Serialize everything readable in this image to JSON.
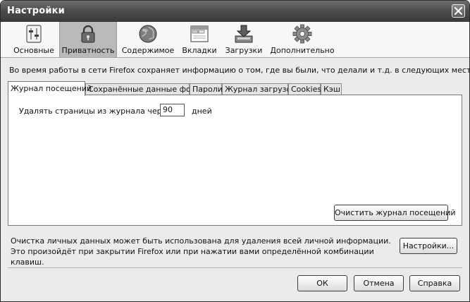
{
  "window": {
    "title": "Настройки"
  },
  "toolbar": {
    "items": [
      {
        "label": "Основные",
        "icon": "switch-panel-icon",
        "active": false
      },
      {
        "label": "Приватность",
        "icon": "padlock-icon",
        "active": true
      },
      {
        "label": "Содержимое",
        "icon": "globe-icon",
        "active": false
      },
      {
        "label": "Вкладки",
        "icon": "tabbed-window-icon",
        "active": false
      },
      {
        "label": "Загрузки",
        "icon": "download-tray-icon",
        "active": false
      },
      {
        "label": "Дополнительно",
        "icon": "gear-icon",
        "active": false
      }
    ]
  },
  "intro": "Во время работы в сети Firefox сохраняет информацию о том, где вы были, что делали и т.д. в следующих местах:",
  "tabs": [
    {
      "label": "Журнал посещений",
      "active": true
    },
    {
      "label": "Сохранённые данные форм",
      "active": false
    },
    {
      "label": "Пароли",
      "active": false
    },
    {
      "label": "Журнал загрузок",
      "active": false
    },
    {
      "label": "Cookies",
      "active": false
    },
    {
      "label": "Кэш",
      "active": false
    }
  ],
  "history": {
    "delete_label": "Удалять страницы из журнала через",
    "days_value": "90",
    "days_unit": "дней",
    "clear_button": "Очистить журнал посещений"
  },
  "clear_private": {
    "text": "Очистка личных данных может быть использована для удаления всей личной информации. Это произойдёт при закрытии Firefox или при нажатии вами определённой комбинации клавиш.",
    "settings_button": "Настройки..."
  },
  "footer": {
    "ok": "ОК",
    "cancel": "Отмена",
    "help": "Справка"
  }
}
